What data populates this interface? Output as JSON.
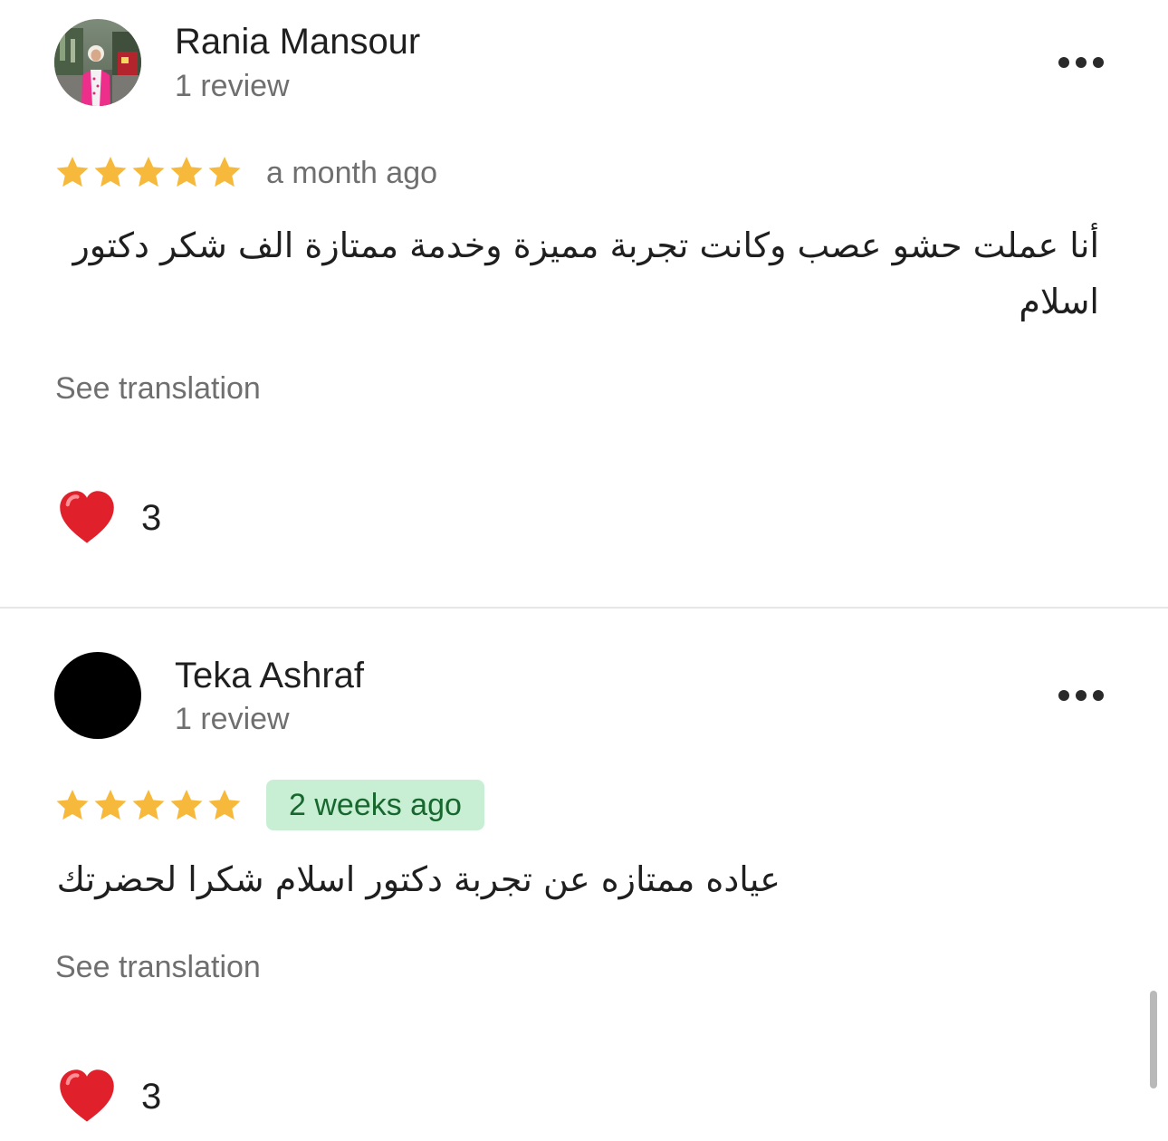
{
  "colors": {
    "star": "#f6b93b",
    "accent_green": "#17672e",
    "highlight_bg": "#c8efd4",
    "muted": "#6f6f6f",
    "heart": "#e0202a"
  },
  "icons": {
    "star": "star-icon",
    "more": "more-options-icon",
    "heart": "heart-icon"
  },
  "reviews": [
    {
      "author": "Rania Mansour",
      "review_count": "1 review",
      "rating": 5,
      "time": "a month ago",
      "text": "أنا عملت حشو عصب وكانت تجربة مميزة وخدمة ممتازة الف شكر دكتور اسلام",
      "translate_label": "See translation",
      "reactions": "3"
    },
    {
      "author": "Teka Ashraf",
      "review_count": "1 review",
      "rating": 5,
      "time": "2 weeks ago",
      "text": "عياده ممتازه عن تجربة دكتور اسلام شكرا لحضرتك",
      "translate_label": "See translation",
      "reactions": "3"
    }
  ]
}
